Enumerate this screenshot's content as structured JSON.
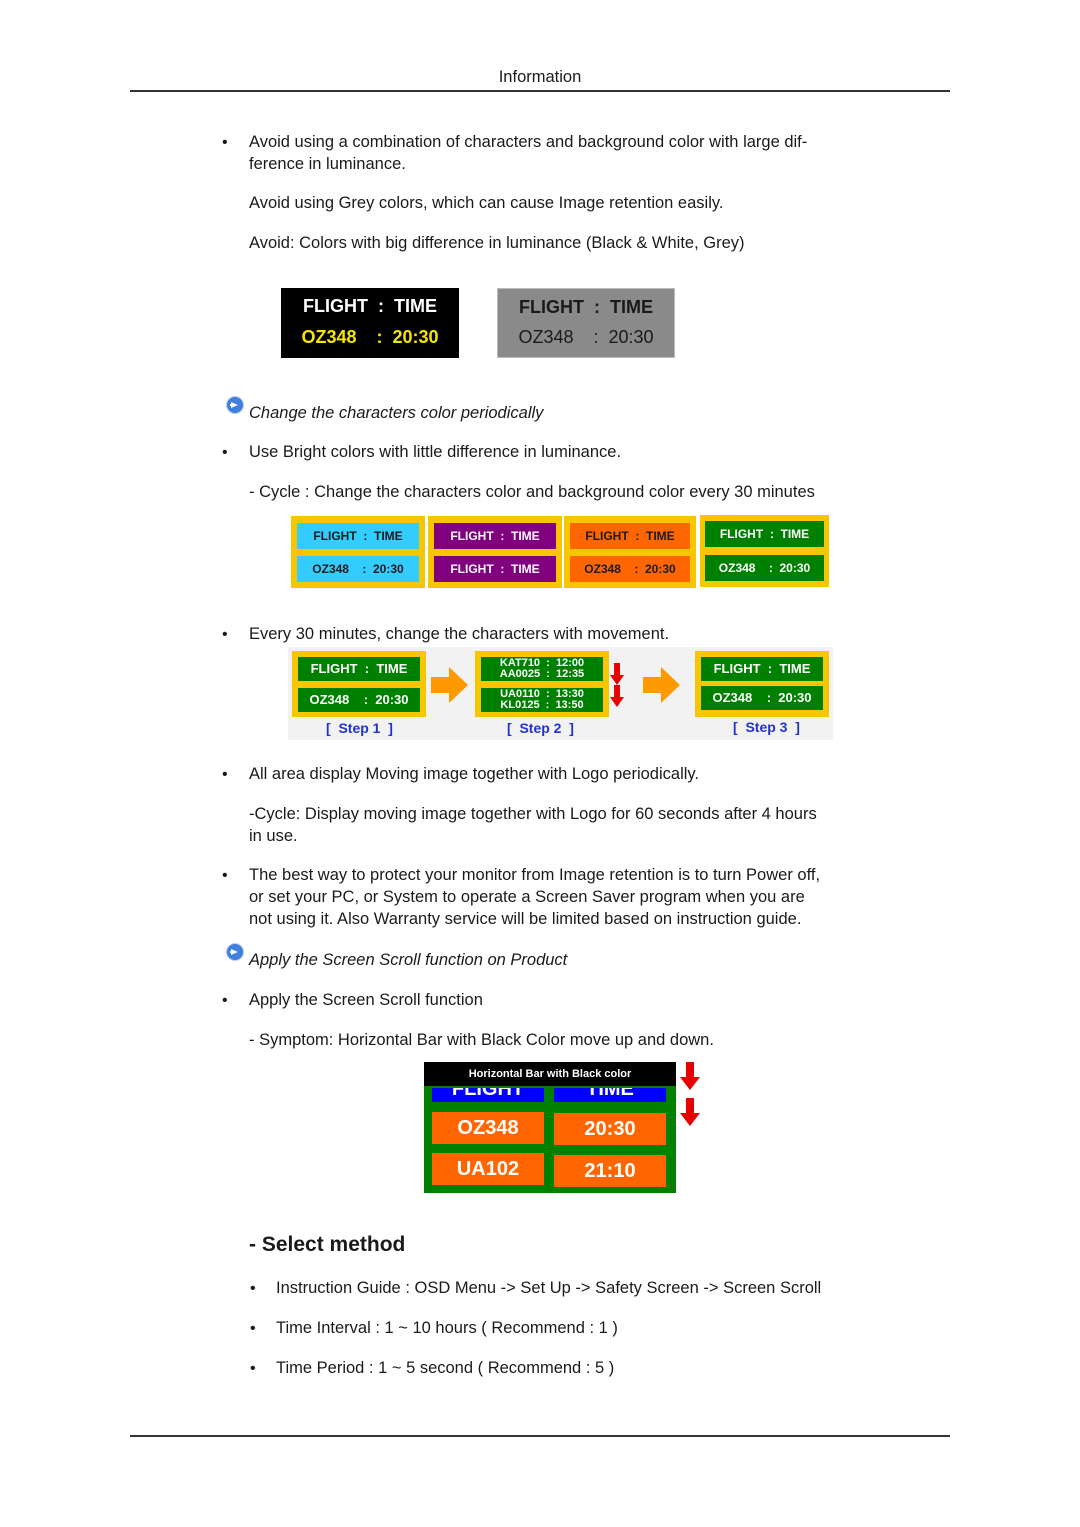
{
  "header": {
    "title": "Information"
  },
  "section1": {
    "bullet": "Avoid using a combination of characters and background color with large dif-",
    "bullet_cont": "ference in luminance.",
    "para1": "Avoid using Grey colors, which can cause Image retention easily.",
    "para2": "Avoid: Colors with big difference in luminance (Black & White, Grey)",
    "examples": [
      {
        "row1": "FLIGHT  :  TIME",
        "row2": "OZ348    :  20:30",
        "bg": "#000000",
        "row1_color": "#ffffff",
        "row2_color": "#f5e600"
      },
      {
        "row1": "FLIGHT  :  TIME",
        "row2": "OZ348    :  20:30",
        "bg": "#8a8a8a",
        "row1_color": "#1a1a1a",
        "row2_color": "#1a1a1a"
      }
    ]
  },
  "section2": {
    "heading_icon": "arrow-circle-icon",
    "heading": "Change the characters color periodically",
    "bullet": "Use Bright colors with little difference in luminance.",
    "cycle": "- Cycle : Change the characters color and background color every 30 minutes",
    "panels": [
      {
        "row1": "FLIGHT  :  TIME",
        "row2": "OZ348    :  20:30",
        "bg": "#33ccff",
        "fg": "#1a1a1a"
      },
      {
        "row1": "FLIGHT  :  TIME",
        "row2": "FLIGHT  :  TIME",
        "bg": "#800080",
        "fg": "#ffffff"
      },
      {
        "row1": "FLIGHT  :  TIME",
        "row2": "OZ348    :  20:30",
        "bg": "#ff6600",
        "fg": "#1a1a1a"
      },
      {
        "row1": "FLIGHT  :  TIME",
        "row2": "OZ348    :  20:30",
        "bg": "#008000",
        "fg": "#ffffff"
      }
    ],
    "frame_color": "#f7c600"
  },
  "section3": {
    "bullet": "Every 30 minutes, change the characters with movement.",
    "steps": [
      {
        "label": "[  Step 1  ]",
        "row1": "FLIGHT  :  TIME",
        "row2": "OZ348    :  20:30"
      },
      {
        "label": "[  Step 2  ]",
        "row1": "KAT710  :  12:00\nAA0025  :  12:35",
        "row2": "UA0110  :  13:30\nKL0125  :  13:50"
      },
      {
        "label": "[  Step 3  ]",
        "row1": "FLIGHT  :  TIME",
        "row2": "OZ348    :  20:30"
      }
    ],
    "arrow_color": "#ff9900",
    "down_arrow_color": "#e60000",
    "panel_bg": "#008000",
    "panel_fg": "#ffffff"
  },
  "section4": {
    "bullet": "All area display Moving image together with Logo periodically.",
    "cycle_line1": "-Cycle: Display moving image together with Logo for 60 seconds after 4 hours",
    "cycle_line2": "in use.",
    "best_way_line1": "The best way to protect your monitor from Image retention is to turn Power off,",
    "best_way_line2": "or set your PC, or System to operate a Screen Saver program when you are",
    "best_way_line3": "not using it. Also Warranty service will be limited based on instruction guide."
  },
  "section5": {
    "heading_icon": "arrow-circle-icon",
    "heading": "Apply the Screen Scroll function on Product",
    "bullet": "Apply the Screen Scroll function",
    "symptom": "- Symptom: Horizontal Bar with Black Color move up and down.",
    "scroll_image": {
      "bar_label": "Horizontal Bar with Black color",
      "header_cells": [
        "FLIGHT",
        "TIME"
      ],
      "rows": [
        [
          "OZ348",
          "20:30"
        ],
        [
          "UA102",
          "21:10"
        ]
      ],
      "frame_color": "#008000",
      "header_color": "#0000ff",
      "cell_color": "#ff6600"
    }
  },
  "select_method": {
    "title": "- Select method",
    "items": [
      "Instruction Guide : OSD Menu -> Set Up -> Safety Screen -> Screen Scroll",
      "Time Interval : 1 ~ 10 hours ( Recommend : 1 )",
      "Time Period : 1 ~ 5 second ( Recommend : 5 )"
    ]
  },
  "bullet_glyph": "•"
}
